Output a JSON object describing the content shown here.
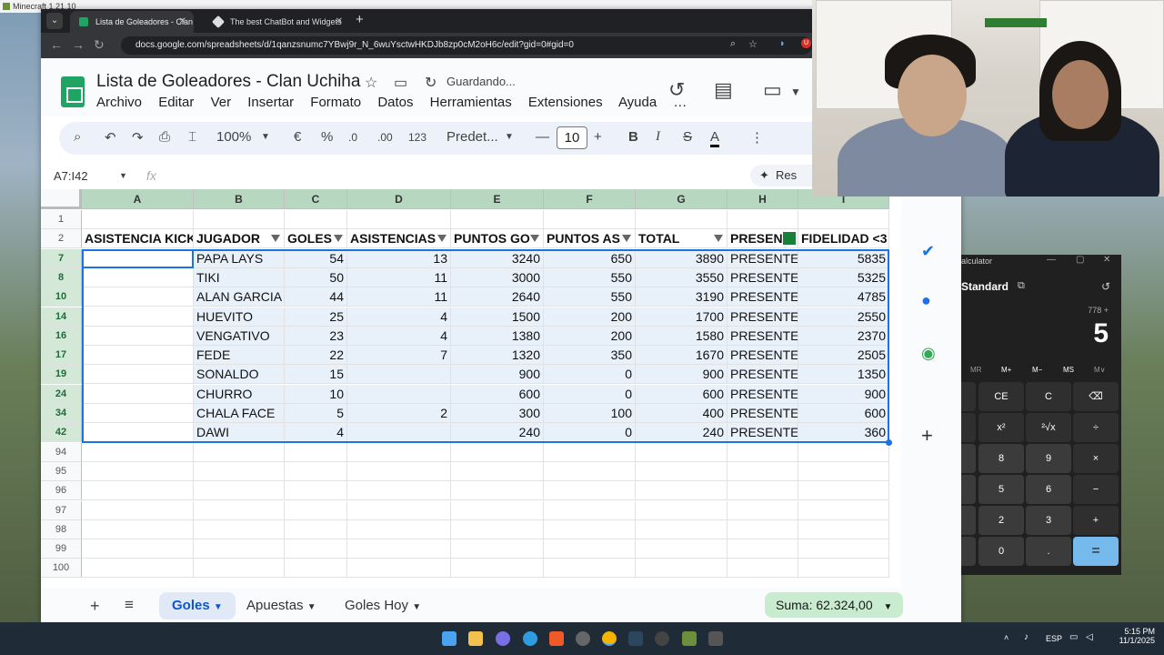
{
  "window": {
    "title": "Minecraft 1.21.10"
  },
  "browser": {
    "tabs": [
      {
        "label": "Lista de Goleadores - Clan Uchi",
        "active": true
      },
      {
        "label": "The best ChatBot and Widgets",
        "active": false
      }
    ],
    "url": "docs.google.com/spreadsheets/d/1qanzsnumc7YBwj9r_N_6wuYsctwHKDJb8zp0cM2oH6c/edit?gid=0#gid=0"
  },
  "doc": {
    "title": "Lista de Goleadores - Clan  Uchiha",
    "status": "Guardando...",
    "menu": [
      "Archivo",
      "Editar",
      "Ver",
      "Insertar",
      "Formato",
      "Datos",
      "Herramientas",
      "Extensiones",
      "Ayuda"
    ]
  },
  "toolbar": {
    "zoom": "100%",
    "currency": "€",
    "percent": "%",
    "dec_minus": ".0",
    "dec_plus": ".00",
    "numfmt": "123",
    "font": "Predet...",
    "font_size": "10"
  },
  "formula_bar": {
    "namebox": "A7:I42",
    "fx": "fx",
    "resumen": "Res"
  },
  "columns": [
    "A",
    "B",
    "C",
    "D",
    "E",
    "F",
    "G",
    "H",
    "I"
  ],
  "header_row": {
    "row": "2",
    "cells": [
      "ASISTENCIA KICK",
      "JUGADOR",
      "GOLES",
      "ASISTENCIAS",
      "PUNTOS GO",
      "PUNTOS AS",
      "TOTAL",
      "PRESEN",
      "FIDELIDAD <3"
    ]
  },
  "rows": [
    {
      "row": "7",
      "cells": [
        "",
        "PAPA LAYS",
        "54",
        "13",
        "3240",
        "650",
        "3890",
        "PRESENTE",
        "5835"
      ]
    },
    {
      "row": "8",
      "cells": [
        "",
        "TIKI",
        "50",
        "11",
        "3000",
        "550",
        "3550",
        "PRESENTE",
        "5325"
      ]
    },
    {
      "row": "10",
      "cells": [
        "",
        "ALAN GARCIA",
        "44",
        "11",
        "2640",
        "550",
        "3190",
        "PRESENTE",
        "4785"
      ]
    },
    {
      "row": "14",
      "cells": [
        "",
        "HUEVITO",
        "25",
        "4",
        "1500",
        "200",
        "1700",
        "PRESENTE",
        "2550"
      ]
    },
    {
      "row": "16",
      "cells": [
        "",
        "VENGATIVO",
        "23",
        "4",
        "1380",
        "200",
        "1580",
        "PRESENTE",
        "2370"
      ]
    },
    {
      "row": "17",
      "cells": [
        "",
        "FEDE",
        "22",
        "7",
        "1320",
        "350",
        "1670",
        "PRESENTE",
        "2505"
      ]
    },
    {
      "row": "19",
      "cells": [
        "",
        "SONALDO",
        "15",
        "",
        "900",
        "0",
        "900",
        "PRESENTE",
        "1350"
      ]
    },
    {
      "row": "24",
      "cells": [
        "",
        "CHURRO",
        "10",
        "",
        "600",
        "0",
        "600",
        "PRESENTE",
        "900"
      ]
    },
    {
      "row": "34",
      "cells": [
        "",
        "CHALA FACE",
        "5",
        "2",
        "300",
        "100",
        "400",
        "PRESENTE",
        "600"
      ]
    },
    {
      "row": "42",
      "cells": [
        "",
        "DAWI",
        "4",
        "",
        "240",
        "0",
        "240",
        "PRESENTE",
        "360"
      ]
    }
  ],
  "empty_rows": [
    "94",
    "95",
    "96",
    "97",
    "98",
    "99",
    "100"
  ],
  "first_row": "1",
  "sheet_tabs": [
    {
      "label": "Goles",
      "active": true
    },
    {
      "label": "Apuestas",
      "active": false
    },
    {
      "label": "Goles Hoy",
      "active": false
    }
  ],
  "suma": "Suma: 62.324,00",
  "calculator": {
    "title": "alculator",
    "mode": "Standard",
    "expression": "778 +",
    "display": "5",
    "memory": [
      "MR",
      "M+",
      "M−",
      "MS",
      "M∨"
    ],
    "keys": [
      "CE",
      "C",
      "⌫",
      "x²",
      "²√x",
      "÷",
      "8",
      "9",
      "×",
      "5",
      "6",
      "−",
      "2",
      "3",
      "+",
      "0",
      ".",
      "="
    ]
  },
  "taskbar": {
    "lang": "ESP",
    "time": "5:15 PM",
    "date": "11/1/2025"
  },
  "accent": "#1a73e8",
  "sheets_green": "#1fa463"
}
